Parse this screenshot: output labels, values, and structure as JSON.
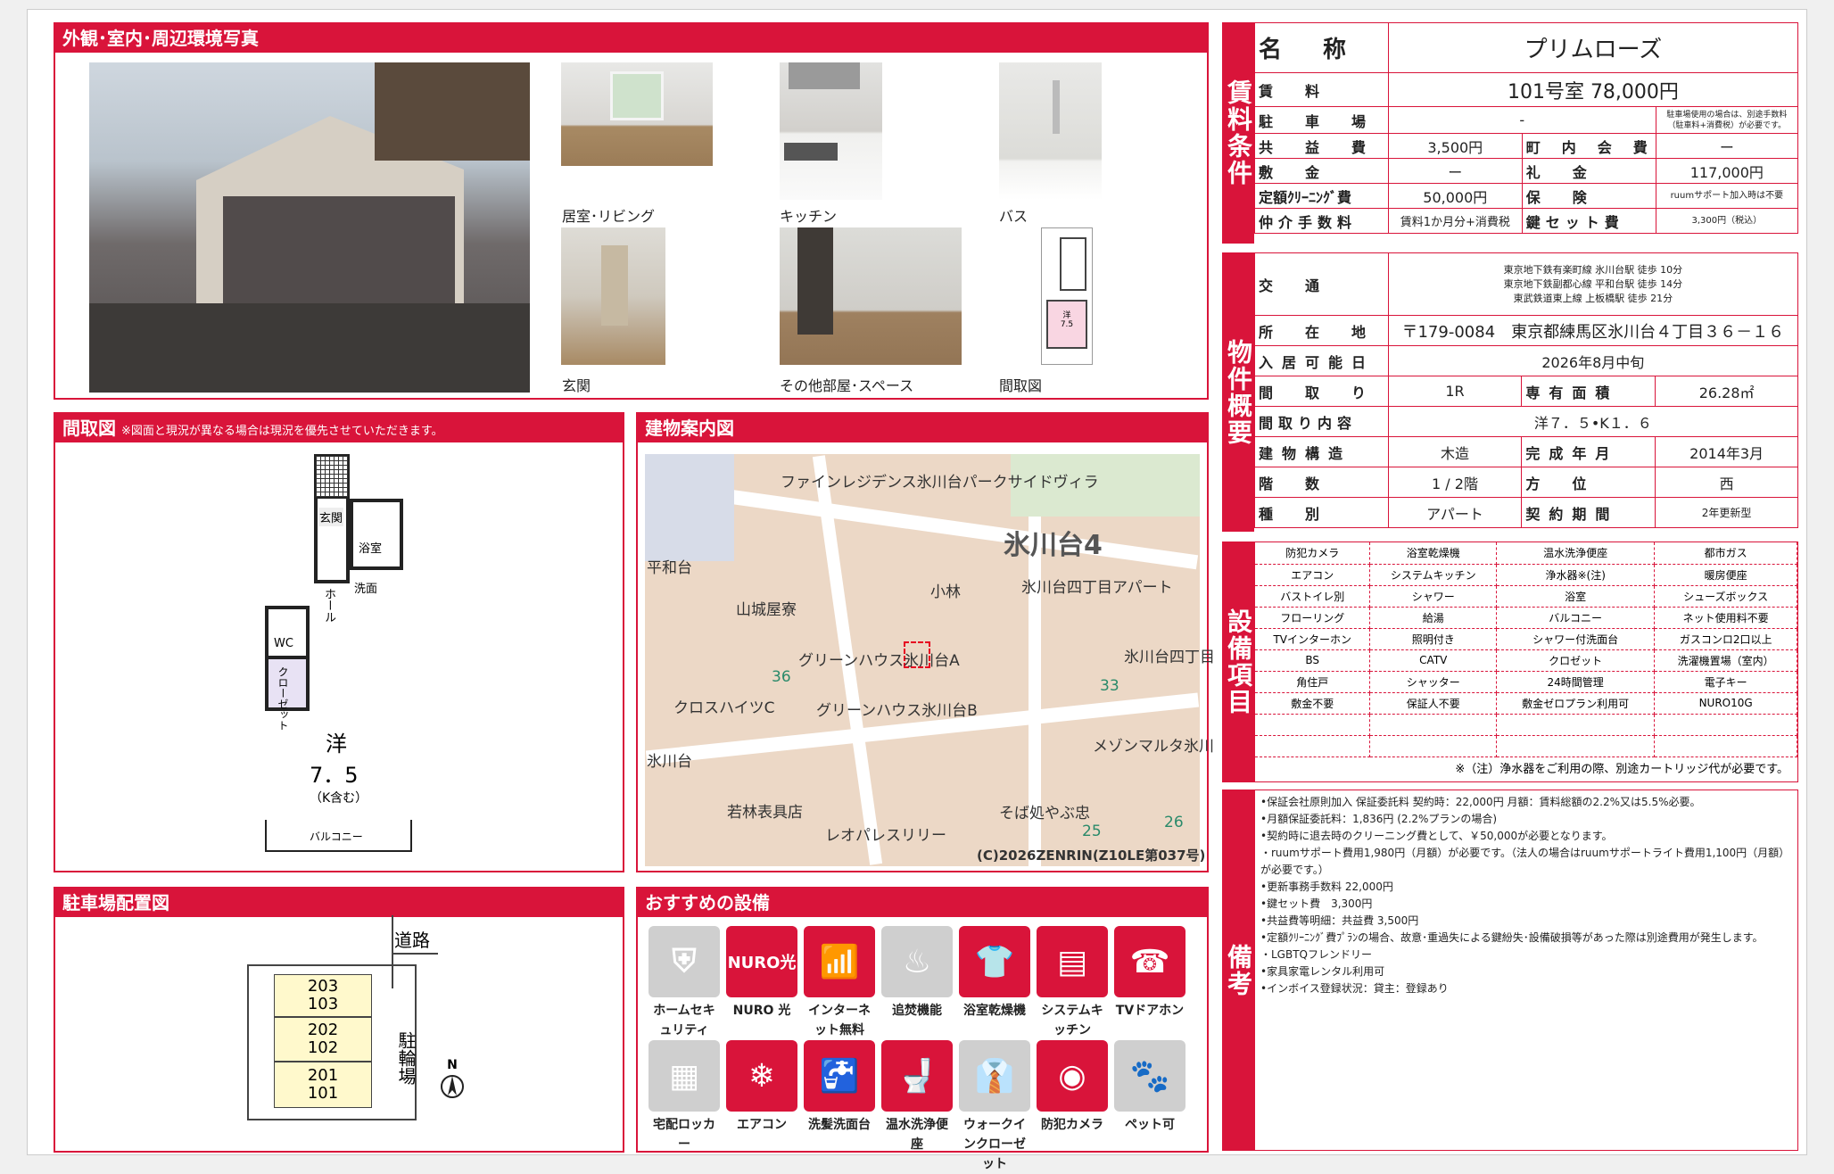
{
  "photos": {
    "header": "外観･室内･周辺環境写真",
    "captions": [
      "居室･リビング",
      "キッチン",
      "バス",
      "玄関",
      "その他部屋･スペース",
      "間取図"
    ]
  },
  "floorplan": {
    "header": "間取図",
    "note": "※図面と現況が異なる場合は現況を優先させていただきます。",
    "rooms": {
      "entrance": "玄関",
      "bath": "浴室",
      "hall": "ホール",
      "washroom": "洗面",
      "wc": "WC",
      "closet": "クローゼット",
      "main": "洋",
      "size": "7．5",
      "sub": "（K含む）",
      "balcony": "バルコニー"
    }
  },
  "map": {
    "header": "建物案内図",
    "labels": [
      "ファインレジデンス氷川台パークサイドヴィラ",
      "氷川台4",
      "氷川台四丁目アパート",
      "小林",
      "山城屋寮",
      "平和台",
      "グリーンハウス氷川台A",
      "グリーンハウス氷川台B",
      "クロスハイツC",
      "氷川台四丁目",
      "36",
      "33",
      "メゾンマルタ氷川",
      "氷川台",
      "若林表具店",
      "そば処やぶ忠",
      "レオパレスリリー",
      "25",
      "26"
    ],
    "copyright": "(C)2026ZENRIN(Z10LE第037号)"
  },
  "parking": {
    "header": "駐車場配置図",
    "road": "道路",
    "bike": "駐輪場",
    "units": [
      [
        "203",
        "103"
      ],
      [
        "202",
        "102"
      ],
      [
        "201",
        "101"
      ]
    ],
    "north": "N"
  },
  "equipment_icons": {
    "header": "おすすめの設備",
    "items": [
      {
        "label": "ホームセキュリティ",
        "icon": "shield-icon",
        "active": false
      },
      {
        "label": "NURO 光",
        "icon": "nuro-icon",
        "text": "NURO光",
        "active": true
      },
      {
        "label": "インターネット無料",
        "icon": "wifi-icon",
        "active": true
      },
      {
        "label": "追焚機能",
        "icon": "bathtub-icon",
        "active": false
      },
      {
        "label": "浴室乾燥機",
        "icon": "bath-dryer-icon",
        "active": true
      },
      {
        "label": "システムキッチン",
        "icon": "kitchen-icon",
        "active": true
      },
      {
        "label": "TVドアホン",
        "icon": "intercom-icon",
        "active": true
      },
      {
        "label": "宅配ロッカー",
        "icon": "locker-icon",
        "active": false
      },
      {
        "label": "エアコン",
        "icon": "aircon-icon",
        "active": true
      },
      {
        "label": "洗髪洗面台",
        "icon": "sink-icon",
        "active": true
      },
      {
        "label": "温水洗浄便座",
        "icon": "toilet-icon",
        "active": true
      },
      {
        "label": "ウォークインクローゼット",
        "icon": "closet-icon",
        "active": false
      },
      {
        "label": "防犯カメラ",
        "icon": "camera-icon",
        "active": true
      },
      {
        "label": "ペット可",
        "icon": "paw-icon",
        "active": false
      }
    ]
  },
  "conditions": {
    "side": "賃料条件",
    "name_label": "名　称",
    "name": "プリムローズ",
    "rent_label": "賃　料",
    "rent": "101号室 78,000円",
    "parking_label": "駐　車　場",
    "parking": "-",
    "parking_note": "駐車場使用の場合は、別途手数料（駐車料+消費税）が必要です。",
    "common_label": "共　益　費",
    "common": "3,500円",
    "assoc_label": "町　内　会　費",
    "assoc": "ー",
    "deposit_label": "敷　金",
    "deposit": "ー",
    "key_money_label": "礼　金",
    "key_money": "117,000円",
    "cleaning_label": "定額ｸﾘｰﾆﾝｸﾞ費",
    "cleaning": "50,000円",
    "insurance_label": "保　険",
    "insurance": "ruumサポート加入時は不要",
    "broker_label": "仲介手数料",
    "broker": "賃料1か月分+消費税",
    "keyset_label": "鍵セット費",
    "keyset": "3,300円（税込）"
  },
  "property": {
    "side": "物件概要",
    "transport_label": "交　通",
    "transport": [
      "東京地下鉄有楽町線 氷川台駅 徒歩 10分",
      "東京地下鉄副都心線 平和台駅 徒歩 14分",
      "東武鉄道東上線 上板橋駅 徒歩 21分"
    ],
    "address_label": "所　在　地",
    "address": "〒179-0084　東京都練馬区氷川台４丁目３６－１６",
    "movein_label": "入居可能日",
    "movein": "2026年8月中旬",
    "layout_label": "間　取　り",
    "layout": "1R",
    "area_label": "専有面積",
    "area": "26.28㎡",
    "detail_label": "間取り内容",
    "detail": "洋７．５•K１．６",
    "structure_label": "建物構造",
    "structure": "木造",
    "built_label": "完成年月",
    "built": "2014年3月",
    "floor_label": "階　数",
    "floor": "1 / 2階",
    "direction_label": "方　位",
    "direction": "西",
    "type_label": "種　別",
    "type": "アパート",
    "contract_label": "契約期間",
    "contract": "2年更新型"
  },
  "facilities": {
    "side": "設備項目",
    "rows": [
      [
        "防犯カメラ",
        "浴室乾燥機",
        "温水洗浄便座",
        "都市ガス"
      ],
      [
        "エアコン",
        "システムキッチン",
        "浄水器※(注)",
        "暖房便座"
      ],
      [
        "バストイレ別",
        "シャワー",
        "浴室",
        "シューズボックス"
      ],
      [
        "フローリング",
        "給湯",
        "バルコニー",
        "ネット使用料不要"
      ],
      [
        "TVインターホン",
        "照明付き",
        "シャワー付洗面台",
        "ガスコンロ2口以上"
      ],
      [
        "BS",
        "CATV",
        "クロゼット",
        "洗濯機置場（室内）"
      ],
      [
        "角住戸",
        "シャッター",
        "24時間管理",
        "電子キー"
      ],
      [
        "敷金不要",
        "保証人不要",
        "敷金ゼロプラン利用可",
        "NURO10G"
      ],
      [
        "",
        "",
        "",
        ""
      ],
      [
        "",
        "",
        "",
        ""
      ]
    ],
    "note": "※（注）浄水器をご利用の際、別途カートリッジ代が必要です。"
  },
  "remarks": {
    "side": "備考",
    "lines": [
      "•保証会社原則加入 保証委託料 契約時：22,000円 月額：賃料総額の2.2%又は5.5%必要。",
      "•月額保証委託料：1,836円 (2.2%プランの場合)",
      "•契約時に退去時のクリーニング費として、￥50,000が必要となります。",
      "・ruumサポート費用1,980円（月額）が必要です。（法人の場合はruumサポートライト費用1,100円（月額）が必要です。）",
      "•更新事務手数料 22,000円",
      "•鍵セット費　3,300円",
      "•共益費等明細：共益費 3,500円",
      "•定額ｸﾘｰﾆﾝｸﾞ費ﾌﾟﾗﾝの場合、故意･重過失による鍵紛失･設備破損等があった際は別途費用が発生します。",
      "・LGBTQフレンドリー",
      "•家具家電レンタル利用可",
      "•インボイス登録状況：貸主：登録あり"
    ]
  }
}
